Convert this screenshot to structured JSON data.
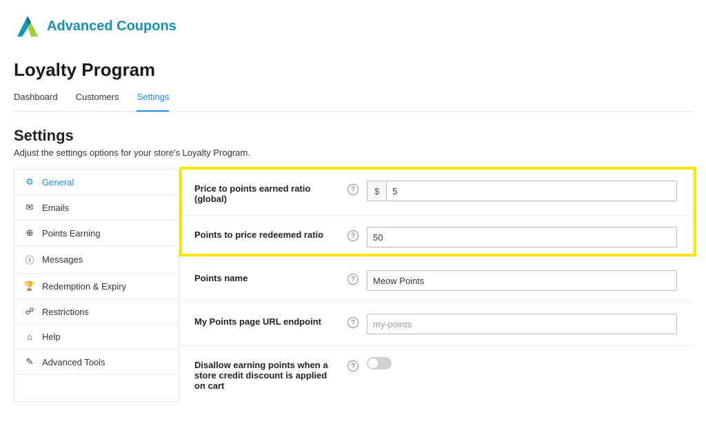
{
  "brand": {
    "name": "Advanced Coupons"
  },
  "header": {
    "title": "Loyalty Program"
  },
  "tabs": [
    {
      "label": "Dashboard",
      "active": false
    },
    {
      "label": "Customers",
      "active": false
    },
    {
      "label": "Settings",
      "active": true
    }
  ],
  "section": {
    "title": "Settings",
    "subtitle": "Adjust the settings options for your store's Loyalty Program."
  },
  "sidebar": {
    "items": [
      {
        "icon": "⚙",
        "label": "General",
        "active": true
      },
      {
        "icon": "✉",
        "label": "Emails",
        "active": false
      },
      {
        "icon": "⊕",
        "label": "Points Earning",
        "active": false
      },
      {
        "icon": "ⓘ",
        "label": "Messages",
        "active": false
      },
      {
        "icon": "🏆",
        "label": "Redemption & Expiry",
        "active": false
      },
      {
        "icon": "☍",
        "label": "Restrictions",
        "active": false
      },
      {
        "icon": "⌂",
        "label": "Help",
        "active": false
      },
      {
        "icon": "✎",
        "label": "Advanced Tools",
        "active": false
      }
    ]
  },
  "settings": {
    "price_to_points": {
      "label": "Price to points earned ratio (global)",
      "prefix": "$",
      "value": "5"
    },
    "points_to_price": {
      "label": "Points to price redeemed ratio",
      "value": "50"
    },
    "points_name": {
      "label": "Points name",
      "value": "Meow Points"
    },
    "url_endpoint": {
      "label": "My Points page URL endpoint",
      "placeholder": "my-points",
      "value": ""
    },
    "disallow_when_credit": {
      "label": "Disallow earning points when a store credit discount is applied on cart",
      "value": false
    }
  }
}
